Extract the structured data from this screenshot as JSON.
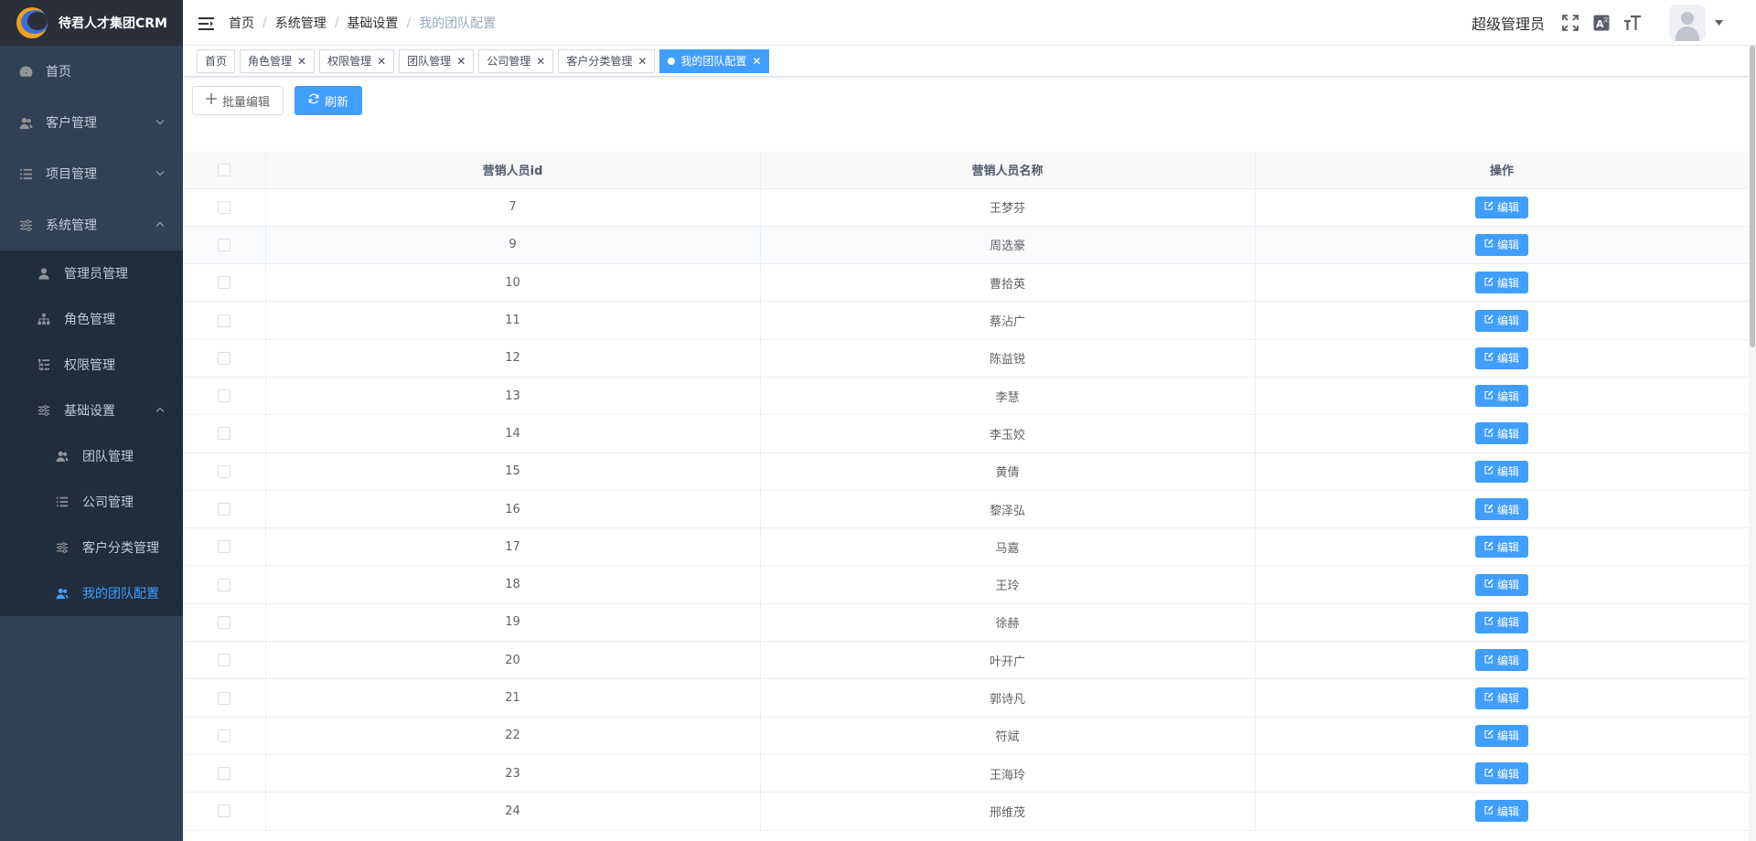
{
  "app": {
    "title": "待君人才集团CRM"
  },
  "sidebar": {
    "items": [
      {
        "label": "首页",
        "icon": "dashboard-icon"
      },
      {
        "label": "客户管理",
        "icon": "users-icon"
      },
      {
        "label": "项目管理",
        "icon": "list-icon"
      },
      {
        "label": "系统管理",
        "icon": "sliders-icon"
      }
    ],
    "system_sub": [
      {
        "label": "管理员管理",
        "icon": "user-icon"
      },
      {
        "label": "角色管理",
        "icon": "org-tree-icon"
      },
      {
        "label": "权限管理",
        "icon": "tree-list-icon"
      },
      {
        "label": "基础设置",
        "icon": "sliders-icon"
      }
    ],
    "basic_sub": [
      {
        "label": "团队管理",
        "icon": "team-icon"
      },
      {
        "label": "公司管理",
        "icon": "list-icon"
      },
      {
        "label": "客户分类管理",
        "icon": "sliders-icon"
      },
      {
        "label": "我的团队配置",
        "icon": "team-icon"
      }
    ]
  },
  "breadcrumb": [
    "首页",
    "系统管理",
    "基础设置",
    "我的团队配置"
  ],
  "header": {
    "user_name": "超级管理员"
  },
  "tags": [
    {
      "label": "首页",
      "closable": false
    },
    {
      "label": "角色管理",
      "closable": true
    },
    {
      "label": "权限管理",
      "closable": true
    },
    {
      "label": "团队管理",
      "closable": true
    },
    {
      "label": "公司管理",
      "closable": true
    },
    {
      "label": "客户分类管理",
      "closable": true
    },
    {
      "label": "我的团队配置",
      "closable": true,
      "active": true
    }
  ],
  "toolbar": {
    "batch_edit_label": "批量编辑",
    "refresh_label": "刷新"
  },
  "table": {
    "columns": [
      "营销人员id",
      "营销人员名称",
      "操作"
    ],
    "edit_label": "编辑",
    "rows": [
      {
        "id": "7",
        "name": "王梦芬"
      },
      {
        "id": "9",
        "name": "周选豪"
      },
      {
        "id": "10",
        "name": "曹拾英"
      },
      {
        "id": "11",
        "name": "蔡沾广"
      },
      {
        "id": "12",
        "name": "陈益锐"
      },
      {
        "id": "13",
        "name": "李慧"
      },
      {
        "id": "14",
        "name": "李玉姣"
      },
      {
        "id": "15",
        "name": "黄倩"
      },
      {
        "id": "16",
        "name": "黎泽弘"
      },
      {
        "id": "17",
        "name": "马嘉"
      },
      {
        "id": "18",
        "name": "王玲"
      },
      {
        "id": "19",
        "name": "徐赫"
      },
      {
        "id": "20",
        "name": "叶开广"
      },
      {
        "id": "21",
        "name": "郭诗凡"
      },
      {
        "id": "22",
        "name": "符斌"
      },
      {
        "id": "23",
        "name": "王海玲"
      },
      {
        "id": "24",
        "name": "邢维茂"
      }
    ]
  },
  "colors": {
    "primary": "#409eff",
    "sidebar_bg": "#304156",
    "submenu_bg": "#1f2d3d",
    "active_text": "#409eff"
  }
}
